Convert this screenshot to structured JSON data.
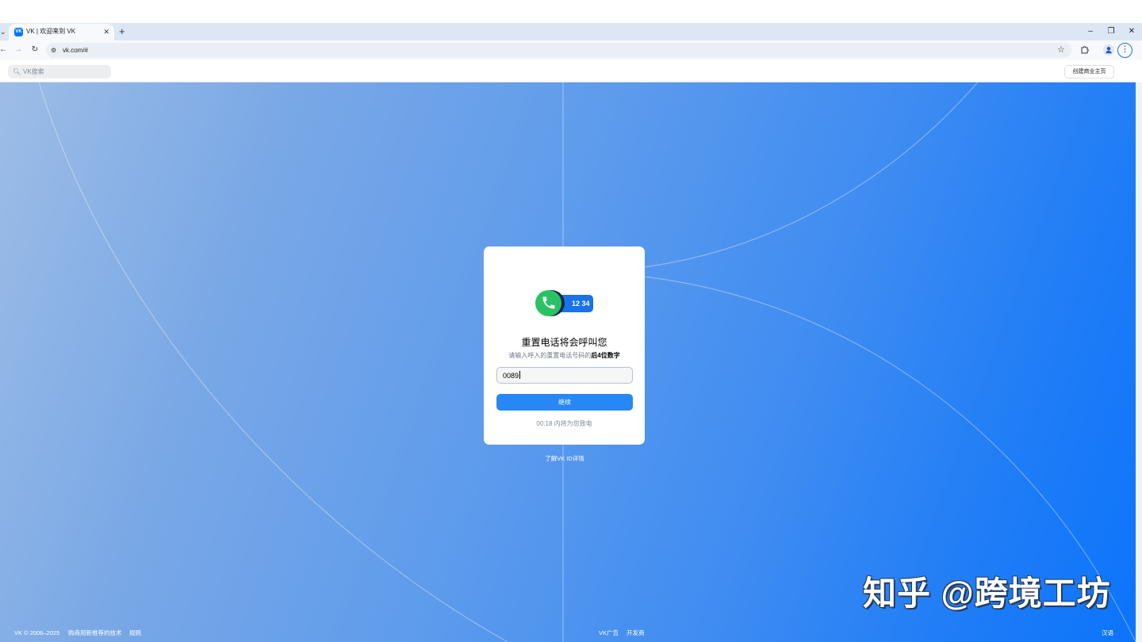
{
  "browser": {
    "tab_title": "VK | 欢迎来到 VK",
    "favicon_text": "VK",
    "url": "vk.com/#"
  },
  "header": {
    "search_placeholder": "VK搜索",
    "business_button": "创建商业主页"
  },
  "card": {
    "illustration_digits": "12 34",
    "illustration_mask": "*",
    "title": "重置电话将会呼叫您",
    "subtitle_prefix": "请输入呼入的重置电话号码的",
    "subtitle_bold": "后4位数字",
    "code_value": "0089",
    "continue_label": "继续",
    "timer_text": "00:18 内将为您致电"
  },
  "learn_more": "了解VK ID详情",
  "footer": {
    "copyright": "VK © 2006–2025",
    "recommendations": "购商用新推荐的技术",
    "rules": "规则",
    "ads": "VK广告",
    "developers": "开发商",
    "language": "汉语"
  },
  "watermark": "知乎 @跨境工坊",
  "colors": {
    "vk_blue": "#0077ff",
    "button_blue": "#2787f5",
    "phone_green": "#2bc265"
  }
}
